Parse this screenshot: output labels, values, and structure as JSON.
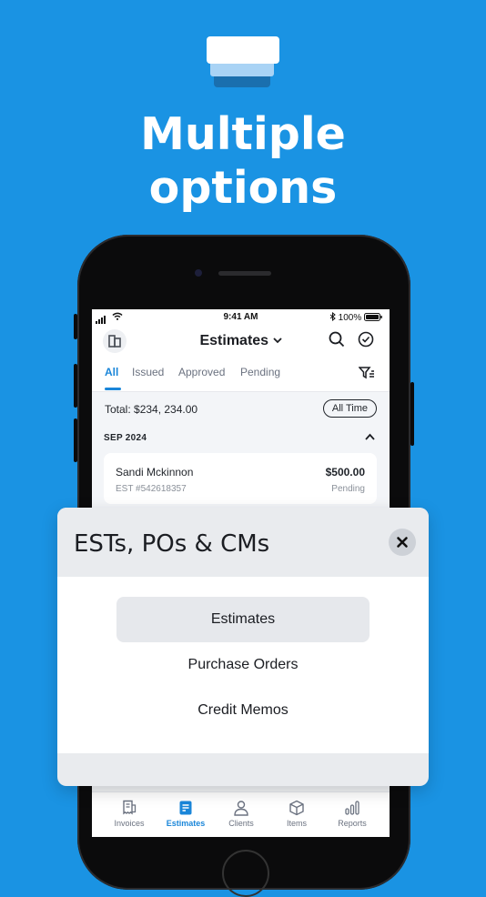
{
  "hero": {
    "headline_line1": "Multiple",
    "headline_line2": "options"
  },
  "status_bar": {
    "time": "9:41 AM",
    "battery": "100%"
  },
  "app": {
    "title": "Estimates",
    "tabs": [
      "All",
      "Issued",
      "Approved",
      "Pending"
    ],
    "active_tab": "All",
    "total_label": "Total: $234, 234.00",
    "time_filter": "All Time",
    "section": "SEP 2024",
    "entry": {
      "client": "Sandi Mckinnon",
      "amount": "$500.00",
      "number": "EST #542618357",
      "status": "Pending"
    }
  },
  "sheet": {
    "title": "ESTs, POs & CMs",
    "options": [
      "Estimates",
      "Purchase Orders",
      "Credit Memos"
    ],
    "selected": "Estimates"
  },
  "bottom_nav": {
    "items": [
      "Invoices",
      "Estimates",
      "Clients",
      "Items",
      "Reports"
    ],
    "active": "Estimates"
  },
  "colors": {
    "background": "#1a93e3",
    "accent": "#1a86d9"
  }
}
